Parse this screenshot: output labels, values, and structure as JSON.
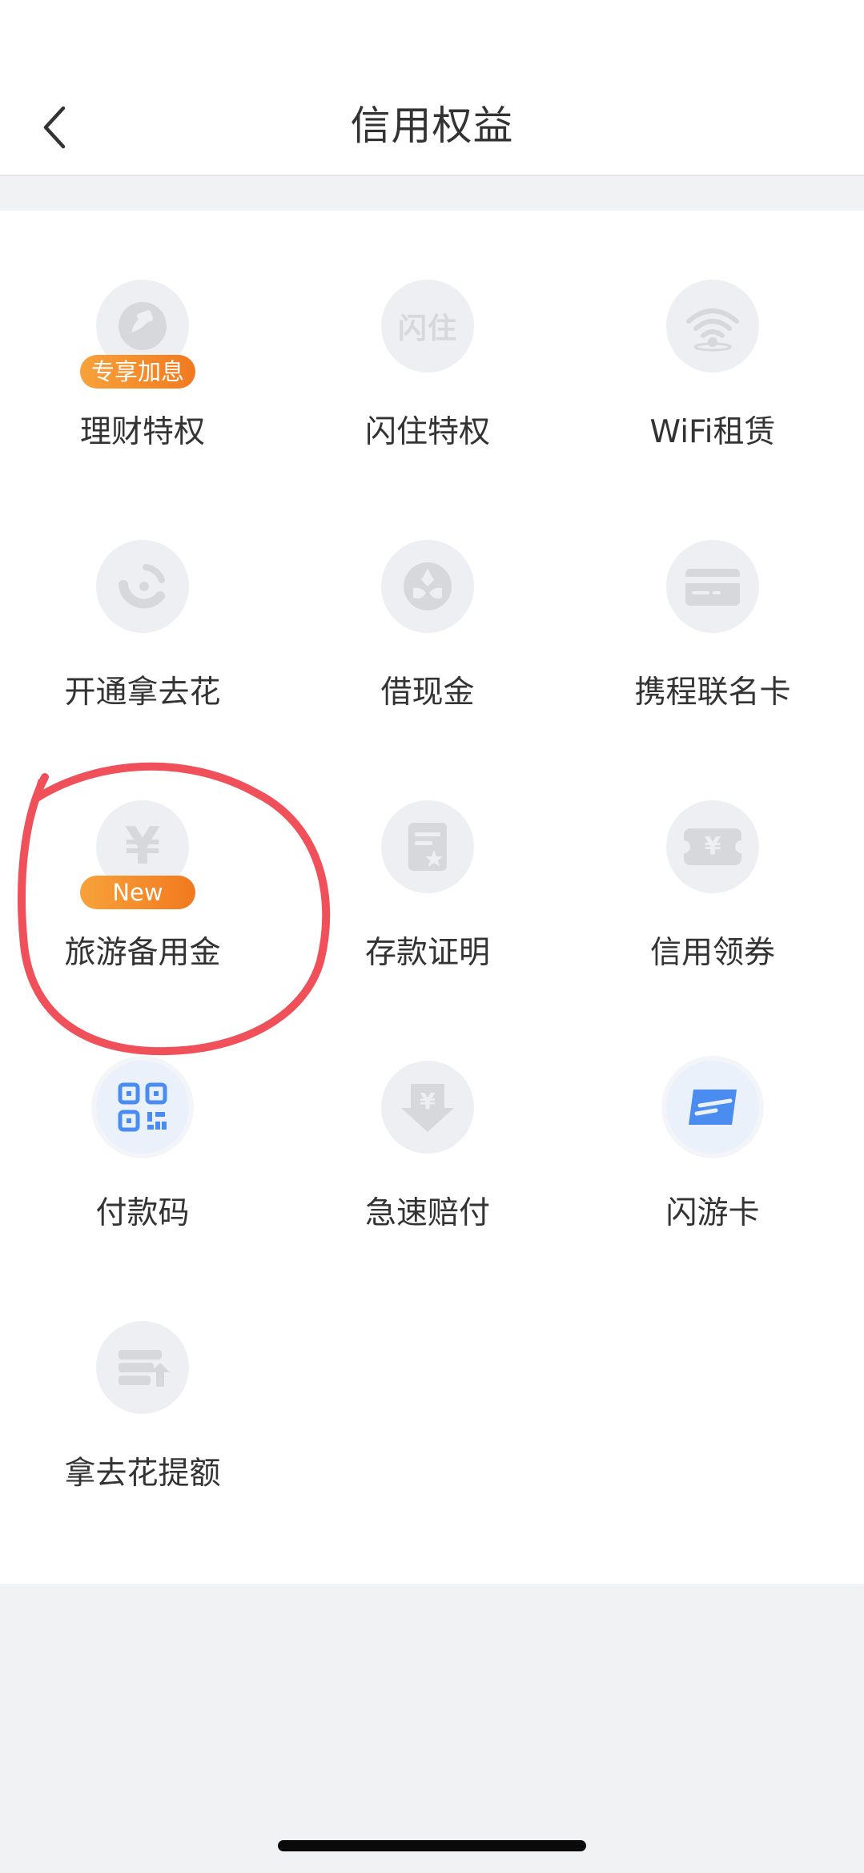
{
  "nav": {
    "title": "信用权益",
    "back_icon": "chevron-left-icon"
  },
  "tiles": [
    {
      "label": "理财特权",
      "icon": "wealth-icon",
      "badge": "专享加息"
    },
    {
      "label": "闪住特权",
      "icon": "shanzhu-icon",
      "icon_text": "闪住"
    },
    {
      "label": "WiFi租赁",
      "icon": "wifi-icon"
    },
    {
      "label": "开通拿去花",
      "icon": "naquhua-icon"
    },
    {
      "label": "借现金",
      "icon": "cash-loan-icon"
    },
    {
      "label": "携程联名卡",
      "icon": "credit-card-icon"
    },
    {
      "label": "旅游备用金",
      "icon": "yuan-icon",
      "badge": "New",
      "icon_text": "¥"
    },
    {
      "label": "存款证明",
      "icon": "deposit-certificate-icon"
    },
    {
      "label": "信用领券",
      "icon": "coupon-icon",
      "icon_text": "¥"
    },
    {
      "label": "付款码",
      "icon": "qr-code-icon"
    },
    {
      "label": "急速赔付",
      "icon": "quick-compensation-icon",
      "icon_text": "¥"
    },
    {
      "label": "闪游卡",
      "icon": "shanyou-card-icon"
    },
    {
      "label": "拿去花提额",
      "icon": "credit-raise-icon"
    }
  ],
  "colors": {
    "icon_gray": "#d6d8dc",
    "icon_blue": "#4a8cf0",
    "badge_orange": "#f28a26",
    "annotation_red": "#f0505a",
    "page_background": "#f1f2f4"
  }
}
